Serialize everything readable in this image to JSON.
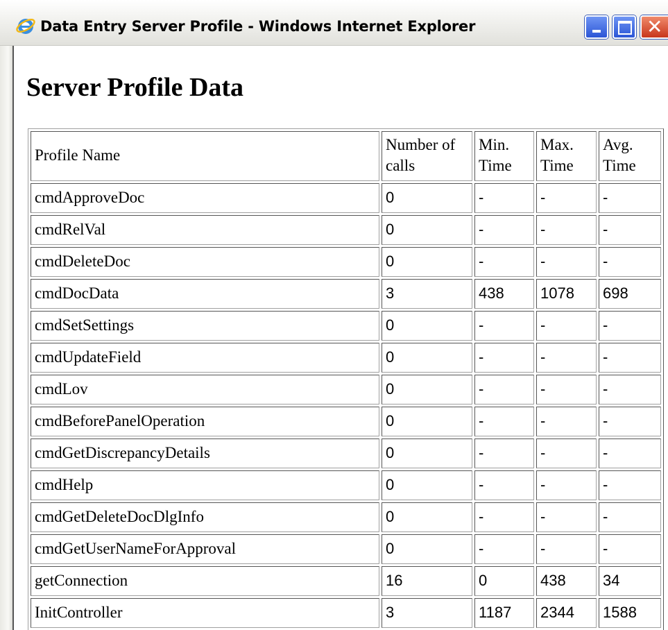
{
  "window": {
    "title": "Data Entry Server Profile - Windows Internet Explorer",
    "icon": "ie-icon"
  },
  "page": {
    "title": "Server Profile Data"
  },
  "table": {
    "headers": [
      "Profile Name",
      "Number of calls",
      "Min. Time",
      "Max. Time",
      "Avg. Time"
    ],
    "rows": [
      [
        "cmdApproveDoc",
        "0",
        "-",
        "-",
        "-"
      ],
      [
        "cmdRelVal",
        "0",
        "-",
        "-",
        "-"
      ],
      [
        "cmdDeleteDoc",
        "0",
        "-",
        "-",
        "-"
      ],
      [
        "cmdDocData",
        "3",
        "438",
        "1078",
        "698"
      ],
      [
        "cmdSetSettings",
        "0",
        "-",
        "-",
        "-"
      ],
      [
        "cmdUpdateField",
        "0",
        "-",
        "-",
        "-"
      ],
      [
        "cmdLov",
        "0",
        "-",
        "-",
        "-"
      ],
      [
        "cmdBeforePanelOperation",
        "0",
        "-",
        "-",
        "-"
      ],
      [
        "cmdGetDiscrepancyDetails",
        "0",
        "-",
        "-",
        "-"
      ],
      [
        "cmdHelp",
        "0",
        "-",
        "-",
        "-"
      ],
      [
        "cmdGetDeleteDocDlgInfo",
        "0",
        "-",
        "-",
        "-"
      ],
      [
        "cmdGetUserNameForApproval",
        "0",
        "-",
        "-",
        "-"
      ],
      [
        "getConnection",
        "16",
        "0",
        "438",
        "34"
      ],
      [
        "InitController",
        "3",
        "1187",
        "2344",
        "1588"
      ]
    ]
  }
}
